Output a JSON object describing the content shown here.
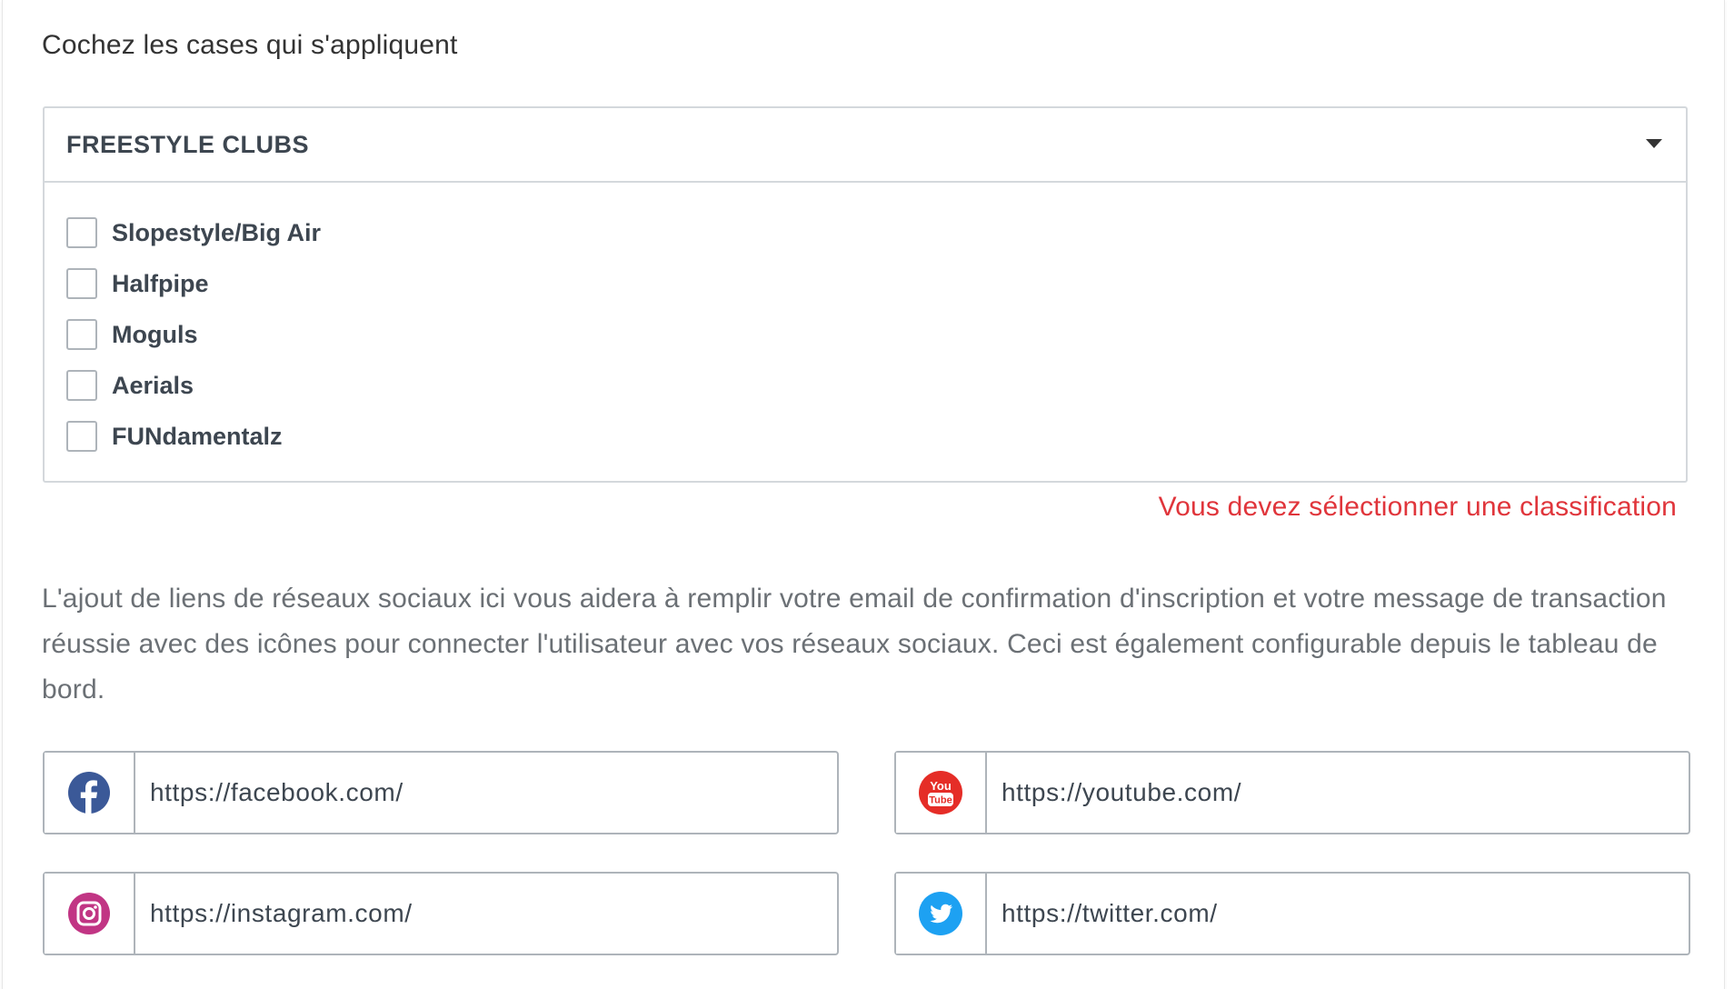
{
  "instruction": "Cochez les cases qui s'appliquent",
  "group": {
    "title": "FREESTYLE CLUBS",
    "options": [
      {
        "label": "Slopestyle/Big Air",
        "checked": false
      },
      {
        "label": "Halfpipe",
        "checked": false
      },
      {
        "label": "Moguls",
        "checked": false
      },
      {
        "label": "Aerials",
        "checked": false
      },
      {
        "label": "FUNdamentalz",
        "checked": false
      }
    ]
  },
  "error": "Vous devez sélectionner une classification",
  "help_text": "L'ajout de liens de réseaux sociaux ici vous aidera à remplir votre email de confirmation d'inscription et votre message de transaction réussie avec des icônes pour connecter l'utilisateur avec vos réseaux sociaux. Ceci est également configurable depuis le tableau de bord.",
  "social": {
    "facebook": {
      "placeholder": "https://facebook.com/",
      "icon": "facebook-icon",
      "color": "#3b5998"
    },
    "youtube": {
      "placeholder": "https://youtube.com/",
      "icon": "youtube-icon",
      "color": "#e52d27"
    },
    "instagram": {
      "placeholder": "https://instagram.com/",
      "icon": "instagram-icon",
      "color": "#c13584"
    },
    "twitter": {
      "placeholder": "https://twitter.com/",
      "icon": "twitter-icon",
      "color": "#1da1f2"
    }
  },
  "icon_text": {
    "youtube_top": "You",
    "youtube_bottom": "Tube"
  }
}
